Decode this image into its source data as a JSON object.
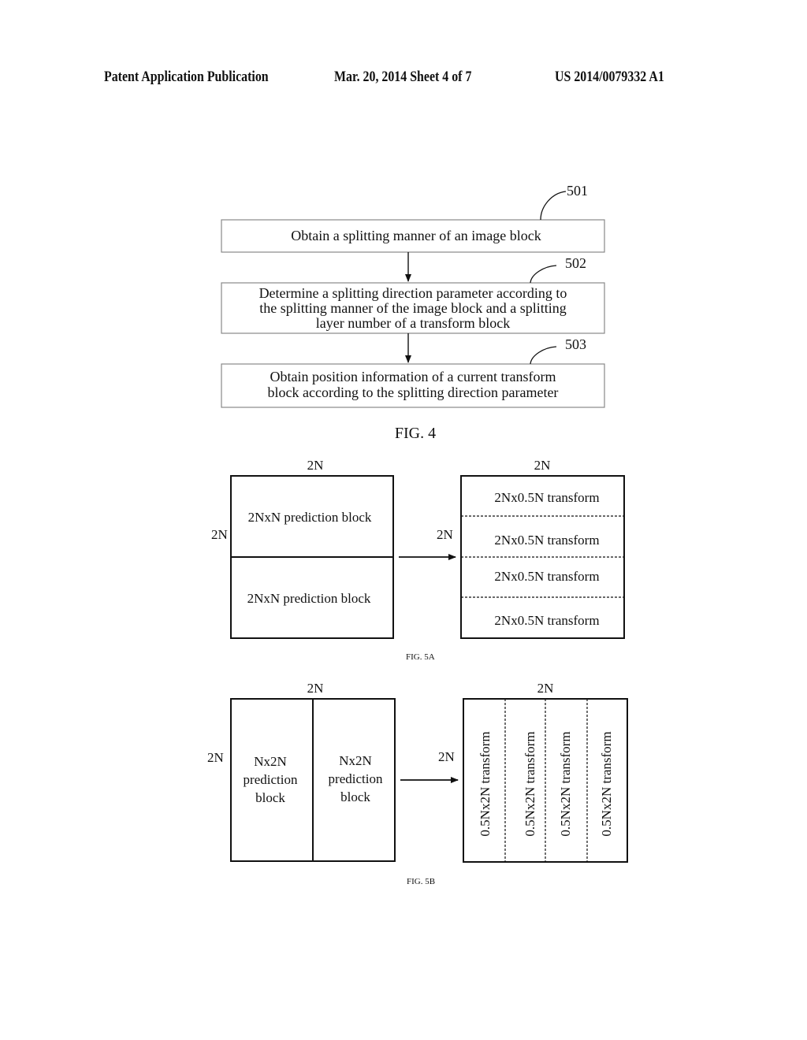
{
  "header": {
    "publication": "Patent Application Publication",
    "date_sheet": "Mar. 20, 2014  Sheet 4 of 7",
    "number": "US 2014/0079332 A1"
  },
  "fig4": {
    "caption": "FIG. 4",
    "steps": [
      {
        "ref": "501",
        "lines": [
          "Obtain a splitting manner of an image block"
        ]
      },
      {
        "ref": "502",
        "lines": [
          "Determine a splitting direction parameter according to",
          "the splitting manner of the image block and a splitting",
          "layer number of a transform block"
        ]
      },
      {
        "ref": "503",
        "lines": [
          "Obtain position information of a current transform",
          "block according to the splitting direction parameter"
        ]
      }
    ]
  },
  "fig5a": {
    "caption": "FIG. 5A",
    "left": {
      "top_dim": "2N",
      "side_dim": "2N",
      "blocks": [
        "2NxN prediction block",
        "2NxN prediction block"
      ]
    },
    "right": {
      "top_dim": "2N",
      "side_dim": "2N",
      "blocks": [
        "2Nx0.5N transform",
        "2Nx0.5N transform",
        "2Nx0.5N transform",
        "2Nx0.5N transform"
      ]
    }
  },
  "fig5b": {
    "caption": "FIG. 5B",
    "left": {
      "top_dim": "2N",
      "side_dim": "2N",
      "blocks": [
        [
          "Nx2N",
          "prediction",
          "block"
        ],
        [
          "Nx2N",
          "prediction",
          "block"
        ]
      ]
    },
    "right": {
      "top_dim": "2N",
      "side_dim": "2N",
      "blocks": [
        "0.5Nx2N transform",
        "0.5Nx2N transform",
        "0.5Nx2N transform",
        "0.5Nx2N transform"
      ]
    }
  }
}
